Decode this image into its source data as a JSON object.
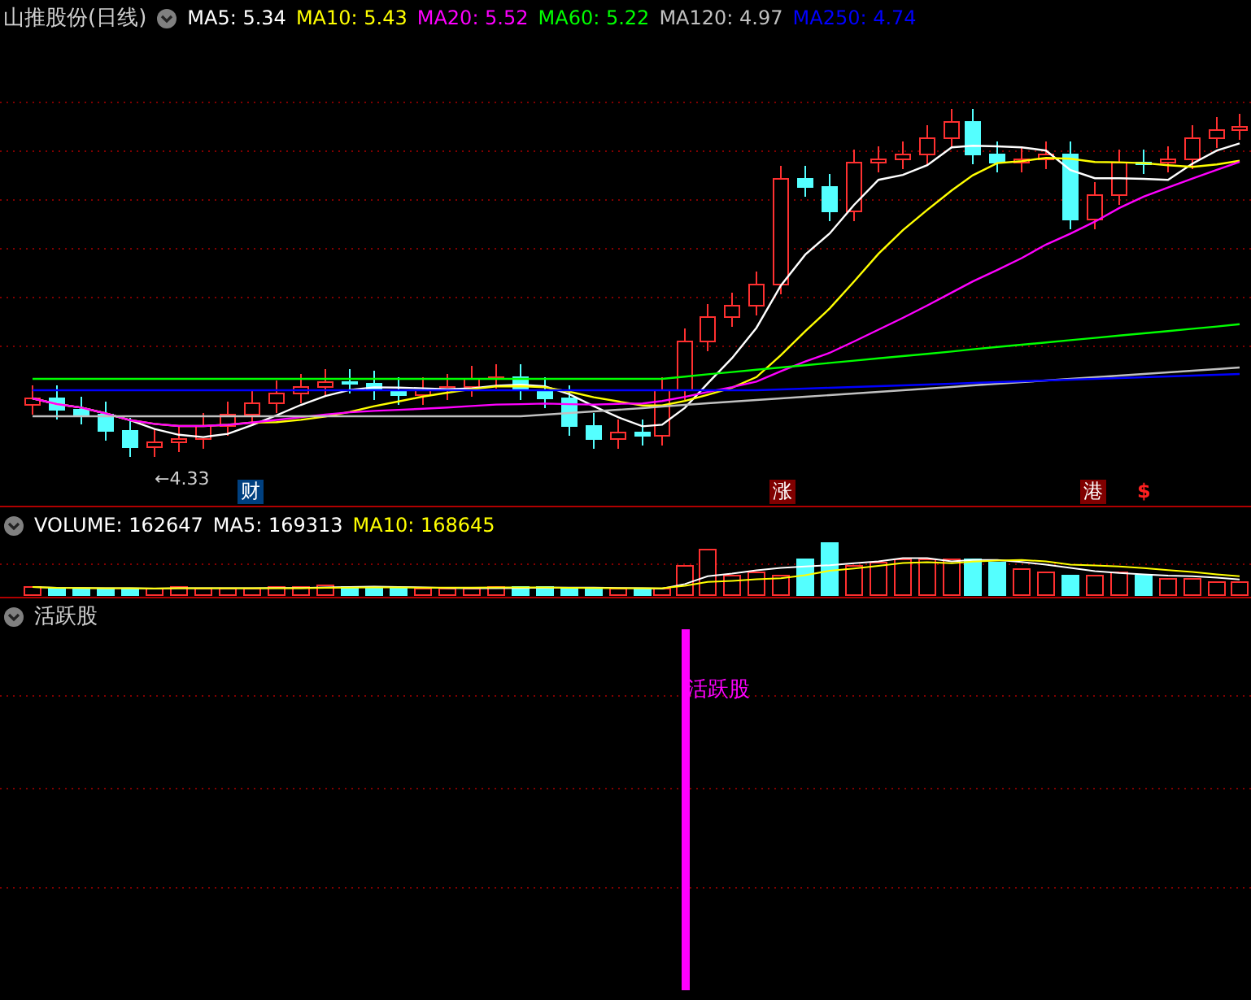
{
  "price_panel": {
    "title": "山推股份(日线)",
    "ma_lines": [
      {
        "label": "MA5: 5.34",
        "color": "#ffffff"
      },
      {
        "label": "MA10: 5.43",
        "color": "#ffff00"
      },
      {
        "label": "MA20: 5.52",
        "color": "#ff00ff"
      },
      {
        "label": "MA60: 5.22",
        "color": "#00ff00"
      },
      {
        "label": "MA120: 4.97",
        "color": "#c0c0c0"
      },
      {
        "label": "MA250: 4.74",
        "color": "#0000ff"
      }
    ],
    "low_label": "←4.33",
    "event_markers": [
      {
        "text": "财",
        "kind": "info"
      },
      {
        "text": "涨",
        "kind": "up"
      },
      {
        "text": "港",
        "kind": "up"
      },
      {
        "text": "$",
        "kind": "flag"
      }
    ]
  },
  "volume_panel": {
    "readings": [
      {
        "label": "VOLUME: 162647",
        "color": "#ffffff"
      },
      {
        "label": "MA5: 169313",
        "color": "#ffffff"
      },
      {
        "label": "MA10: 168645",
        "color": "#ffff00"
      }
    ]
  },
  "indicator_panel": {
    "title": "活跃股",
    "signal_label": "活跃股"
  }
}
